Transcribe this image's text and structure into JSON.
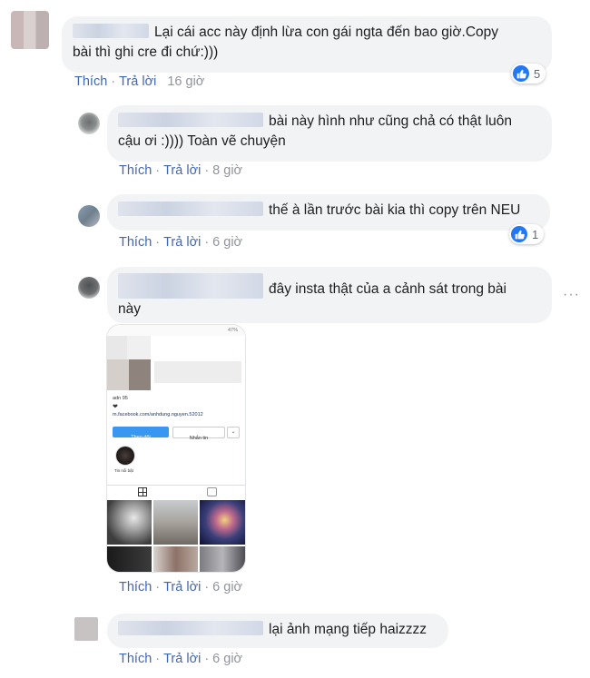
{
  "comments": [
    {
      "id": "c1",
      "text": "Lại cái acc này định lừa con gái ngta đến bao giờ.Copy bài thì ghi cre đi chứ:)))",
      "line1": "Lại cái acc này định lừa con gái ngta đến bao giờ.Copy",
      "line2": "bài thì ghi cre đi chứ:)))",
      "actions": {
        "like": "Thích",
        "reply": "Trả lời",
        "time": "16 giờ"
      },
      "reactions": "5"
    },
    {
      "id": "c2",
      "line1": "bài này hình như cũng chả có thật luôn",
      "line2": "cậu ơi :)))) Toàn vẽ chuyện",
      "actions": {
        "like": "Thích",
        "reply": "Trả lời",
        "time": "8 giờ"
      }
    },
    {
      "id": "c3",
      "line1": "thế à lần trước bài kia thì copy trên NEU",
      "actions": {
        "like": "Thích",
        "reply": "Trả lời",
        "time": "6 giờ"
      },
      "reactions": "1"
    },
    {
      "id": "c4",
      "line1": "đây insta thật của a cảnh sát trong bài",
      "line2": "này",
      "actions": {
        "like": "Thích",
        "reply": "Trả lời",
        "time": "6 giờ"
      },
      "more_icon": "more-dots-icon",
      "screenshot": {
        "status": "47%",
        "handle": "adn 95",
        "heart": "❤",
        "link": "m.facebook.com/anhdung.nguyen.52012",
        "follow_btn": "Theo dõi",
        "message_btn": "Nhắn tin",
        "highlight_label": "Tin nổi bật"
      }
    },
    {
      "id": "c5",
      "line1": "lại ảnh mạng tiếp haizzzz",
      "actions": {
        "like": "Thích",
        "reply": "Trả lời",
        "time": "6 giờ"
      }
    }
  ],
  "colors": {
    "bubble": "#f2f3f5",
    "link": "#4267b2",
    "like_blue": "#2078f4",
    "meta": "#90949c"
  }
}
